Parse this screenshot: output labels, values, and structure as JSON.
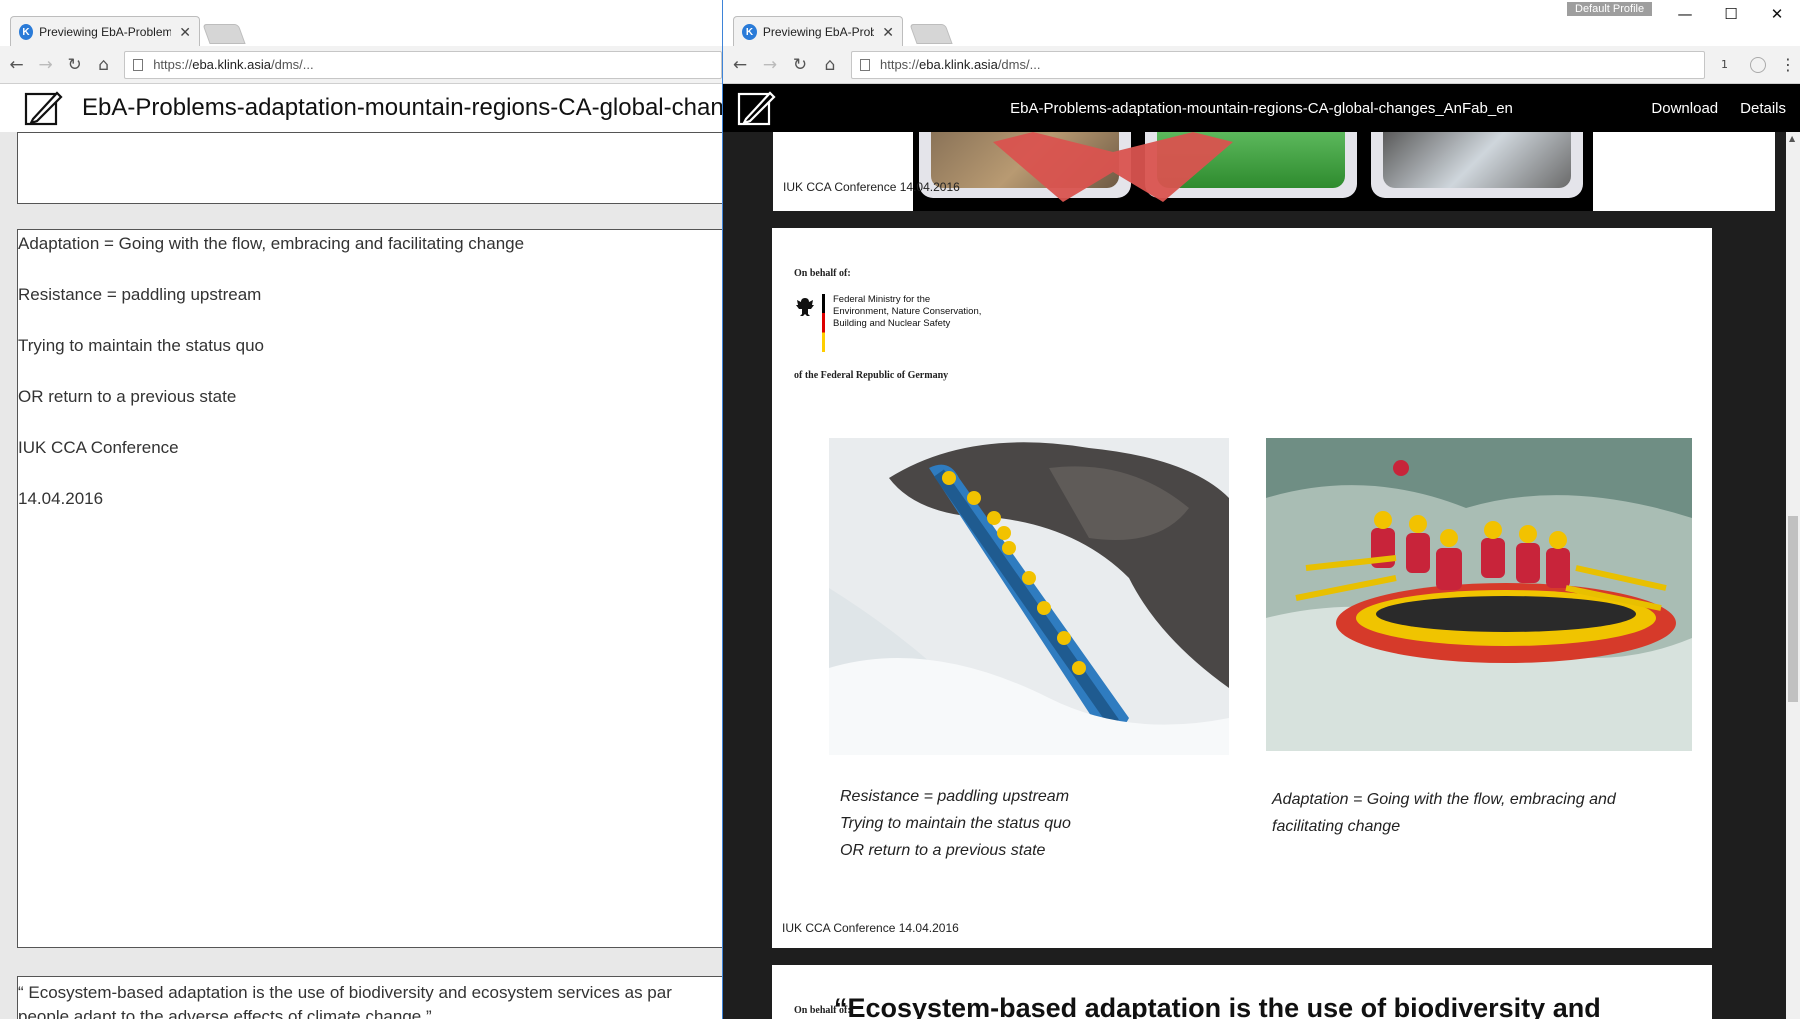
{
  "left_window": {
    "tab": {
      "title": "Previewing EbA-Problem",
      "favicon_letter": "K"
    },
    "toolbar": {
      "url_prefix": "https://",
      "url_host": "eba.klink.asia",
      "url_path": "/dms/..."
    },
    "doc_title": "EbA-Problems-adaptation-mountain-regions-CA-global-changes_",
    "slide_text": [
      "Adaptation = Going with the flow, embracing and facilitating change",
      "Resistance = paddling upstream",
      "Trying to maintain the status quo",
      "OR return to a previous state",
      "IUK CCA Conference",
      "14.04.2016"
    ],
    "bottom_text": [
      "“ Ecosystem-based adaptation is the use of biodiversity and ecosystem services as par",
      "people adapt to the adverse effects of climate change.”"
    ]
  },
  "right_window": {
    "profile_label": "Default Profile",
    "tab": {
      "title": "Previewing EbA-Problem",
      "favicon_letter": "K"
    },
    "toolbar": {
      "url_prefix": "https://",
      "url_host": "eba.klink.asia",
      "url_path": "/dms/...",
      "ext_count": "1"
    },
    "viewer": {
      "title": "EbA-Problems-adaptation-mountain-regions-CA-global-changes_AnFab_en",
      "download_label": "Download",
      "details_label": "Details"
    },
    "prev_slide_footer": "IUK CCA Conference",
    "prev_slide_footer_date": "14.04.2016",
    "slide": {
      "on_behalf": "On behalf of:",
      "ministry_lines": [
        "Federal Ministry for the",
        "Environment, Nature Conservation,",
        "Building and Nuclear Safety"
      ],
      "republic": "of the Federal Republic of Germany",
      "caption_left": [
        "Resistance = paddling upstream",
        "Trying to maintain the status quo",
        "OR return to a previous state"
      ],
      "caption_right": [
        "Adaptation = Going with the flow, embracing and",
        "facilitating change"
      ],
      "footer": "IUK CCA Conference",
      "footer_date": "14.04.2016"
    },
    "next_slide": {
      "on_behalf": "On behalf of:",
      "quote": "“Ecosystem-based adaptation is the use of biodiversity and"
    }
  },
  "colors": {
    "accent": "#3e84d8",
    "viewer_bg": "#1e1e1e",
    "header_bg": "#000000"
  }
}
